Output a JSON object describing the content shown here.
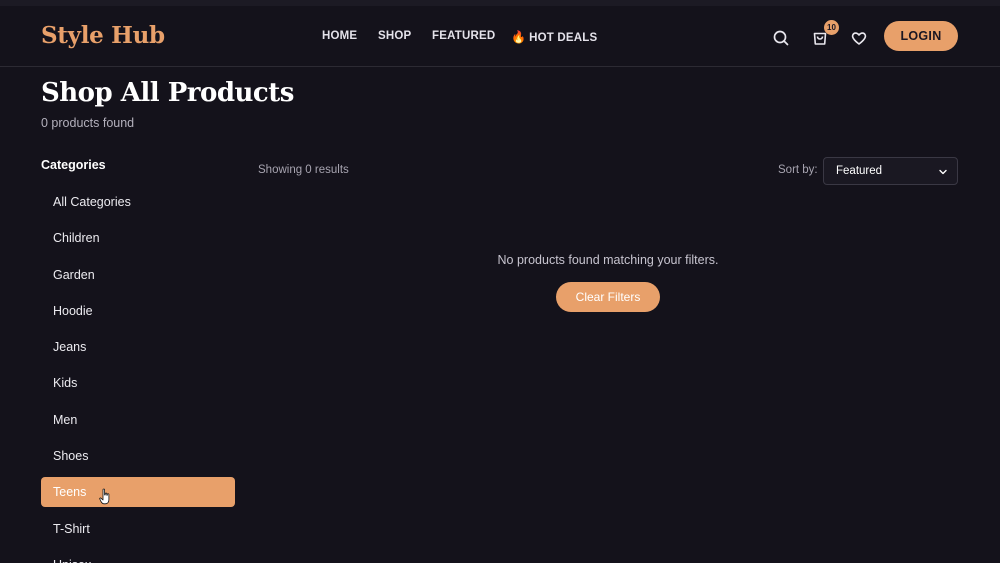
{
  "brand": {
    "name": "Style Hub",
    "accent_color": "#e8a06a",
    "background": "#14121b"
  },
  "nav": [
    {
      "label": "HOME"
    },
    {
      "label": "SHOP"
    },
    {
      "label": "FEATURED"
    },
    {
      "label": "HOT DEALS",
      "icon": "flame-icon"
    }
  ],
  "header_icons": {
    "search": "search-icon",
    "cart": "cart-icon",
    "cart_count": "10",
    "wishlist": "heart-icon"
  },
  "login_label": "LOGIN",
  "page": {
    "title": "Shop All Products",
    "count_text": "0 products found"
  },
  "sidebar": {
    "heading": "Categories",
    "items": [
      {
        "label": "All Categories"
      },
      {
        "label": "Children"
      },
      {
        "label": "Garden"
      },
      {
        "label": "Hoodie"
      },
      {
        "label": "Jeans"
      },
      {
        "label": "Kids"
      },
      {
        "label": "Men"
      },
      {
        "label": "Shoes"
      },
      {
        "label": "Teens",
        "active": true
      },
      {
        "label": "T-Shirt"
      },
      {
        "label": "Unisex"
      }
    ]
  },
  "results": {
    "showing_text": "Showing 0 results",
    "sort_label": "Sort by:",
    "sort_value": "Featured",
    "empty_message": "No products found matching your filters.",
    "clear_button": "Clear Filters"
  }
}
